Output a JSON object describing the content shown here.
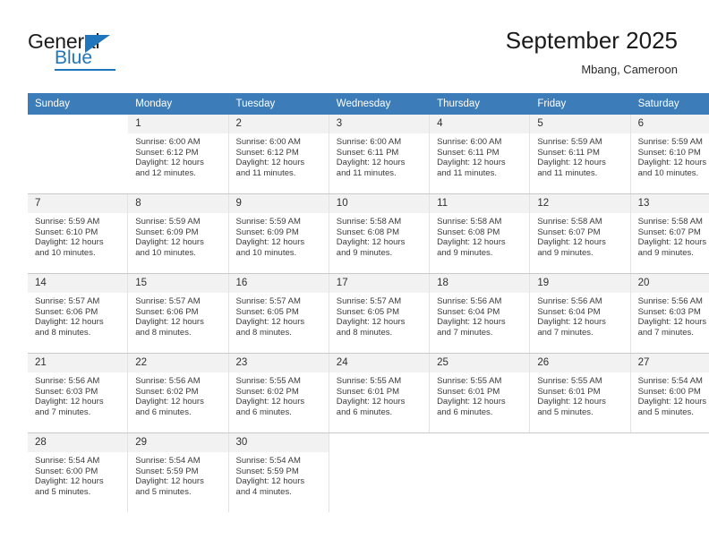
{
  "brand": {
    "name_part1": "General",
    "name_part2": "Blue",
    "accent_color": "#1f76bc"
  },
  "header": {
    "title": "September 2025",
    "subtitle": "Mbang, Cameroon",
    "header_bg": "#3c7cb8"
  },
  "weekday_headers": [
    "Sunday",
    "Monday",
    "Tuesday",
    "Wednesday",
    "Thursday",
    "Friday",
    "Saturday"
  ],
  "labels": {
    "sunrise": "Sunrise:",
    "sunset": "Sunset:",
    "daylight": "Daylight:"
  },
  "weeks": [
    [
      {
        "day": "",
        "blank": true
      },
      {
        "day": "1",
        "sunrise": "Sunrise: 6:00 AM",
        "sunset": "Sunset: 6:12 PM",
        "daylight1": "Daylight: 12 hours",
        "daylight2": "and 12 minutes."
      },
      {
        "day": "2",
        "sunrise": "Sunrise: 6:00 AM",
        "sunset": "Sunset: 6:12 PM",
        "daylight1": "Daylight: 12 hours",
        "daylight2": "and 11 minutes."
      },
      {
        "day": "3",
        "sunrise": "Sunrise: 6:00 AM",
        "sunset": "Sunset: 6:11 PM",
        "daylight1": "Daylight: 12 hours",
        "daylight2": "and 11 minutes."
      },
      {
        "day": "4",
        "sunrise": "Sunrise: 6:00 AM",
        "sunset": "Sunset: 6:11 PM",
        "daylight1": "Daylight: 12 hours",
        "daylight2": "and 11 minutes."
      },
      {
        "day": "5",
        "sunrise": "Sunrise: 5:59 AM",
        "sunset": "Sunset: 6:11 PM",
        "daylight1": "Daylight: 12 hours",
        "daylight2": "and 11 minutes."
      },
      {
        "day": "6",
        "sunrise": "Sunrise: 5:59 AM",
        "sunset": "Sunset: 6:10 PM",
        "daylight1": "Daylight: 12 hours",
        "daylight2": "and 10 minutes."
      }
    ],
    [
      {
        "day": "7",
        "sunrise": "Sunrise: 5:59 AM",
        "sunset": "Sunset: 6:10 PM",
        "daylight1": "Daylight: 12 hours",
        "daylight2": "and 10 minutes."
      },
      {
        "day": "8",
        "sunrise": "Sunrise: 5:59 AM",
        "sunset": "Sunset: 6:09 PM",
        "daylight1": "Daylight: 12 hours",
        "daylight2": "and 10 minutes."
      },
      {
        "day": "9",
        "sunrise": "Sunrise: 5:59 AM",
        "sunset": "Sunset: 6:09 PM",
        "daylight1": "Daylight: 12 hours",
        "daylight2": "and 10 minutes."
      },
      {
        "day": "10",
        "sunrise": "Sunrise: 5:58 AM",
        "sunset": "Sunset: 6:08 PM",
        "daylight1": "Daylight: 12 hours",
        "daylight2": "and 9 minutes."
      },
      {
        "day": "11",
        "sunrise": "Sunrise: 5:58 AM",
        "sunset": "Sunset: 6:08 PM",
        "daylight1": "Daylight: 12 hours",
        "daylight2": "and 9 minutes."
      },
      {
        "day": "12",
        "sunrise": "Sunrise: 5:58 AM",
        "sunset": "Sunset: 6:07 PM",
        "daylight1": "Daylight: 12 hours",
        "daylight2": "and 9 minutes."
      },
      {
        "day": "13",
        "sunrise": "Sunrise: 5:58 AM",
        "sunset": "Sunset: 6:07 PM",
        "daylight1": "Daylight: 12 hours",
        "daylight2": "and 9 minutes."
      }
    ],
    [
      {
        "day": "14",
        "sunrise": "Sunrise: 5:57 AM",
        "sunset": "Sunset: 6:06 PM",
        "daylight1": "Daylight: 12 hours",
        "daylight2": "and 8 minutes."
      },
      {
        "day": "15",
        "sunrise": "Sunrise: 5:57 AM",
        "sunset": "Sunset: 6:06 PM",
        "daylight1": "Daylight: 12 hours",
        "daylight2": "and 8 minutes."
      },
      {
        "day": "16",
        "sunrise": "Sunrise: 5:57 AM",
        "sunset": "Sunset: 6:05 PM",
        "daylight1": "Daylight: 12 hours",
        "daylight2": "and 8 minutes."
      },
      {
        "day": "17",
        "sunrise": "Sunrise: 5:57 AM",
        "sunset": "Sunset: 6:05 PM",
        "daylight1": "Daylight: 12 hours",
        "daylight2": "and 8 minutes."
      },
      {
        "day": "18",
        "sunrise": "Sunrise: 5:56 AM",
        "sunset": "Sunset: 6:04 PM",
        "daylight1": "Daylight: 12 hours",
        "daylight2": "and 7 minutes."
      },
      {
        "day": "19",
        "sunrise": "Sunrise: 5:56 AM",
        "sunset": "Sunset: 6:04 PM",
        "daylight1": "Daylight: 12 hours",
        "daylight2": "and 7 minutes."
      },
      {
        "day": "20",
        "sunrise": "Sunrise: 5:56 AM",
        "sunset": "Sunset: 6:03 PM",
        "daylight1": "Daylight: 12 hours",
        "daylight2": "and 7 minutes."
      }
    ],
    [
      {
        "day": "21",
        "sunrise": "Sunrise: 5:56 AM",
        "sunset": "Sunset: 6:03 PM",
        "daylight1": "Daylight: 12 hours",
        "daylight2": "and 7 minutes."
      },
      {
        "day": "22",
        "sunrise": "Sunrise: 5:56 AM",
        "sunset": "Sunset: 6:02 PM",
        "daylight1": "Daylight: 12 hours",
        "daylight2": "and 6 minutes."
      },
      {
        "day": "23",
        "sunrise": "Sunrise: 5:55 AM",
        "sunset": "Sunset: 6:02 PM",
        "daylight1": "Daylight: 12 hours",
        "daylight2": "and 6 minutes."
      },
      {
        "day": "24",
        "sunrise": "Sunrise: 5:55 AM",
        "sunset": "Sunset: 6:01 PM",
        "daylight1": "Daylight: 12 hours",
        "daylight2": "and 6 minutes."
      },
      {
        "day": "25",
        "sunrise": "Sunrise: 5:55 AM",
        "sunset": "Sunset: 6:01 PM",
        "daylight1": "Daylight: 12 hours",
        "daylight2": "and 6 minutes."
      },
      {
        "day": "26",
        "sunrise": "Sunrise: 5:55 AM",
        "sunset": "Sunset: 6:01 PM",
        "daylight1": "Daylight: 12 hours",
        "daylight2": "and 5 minutes."
      },
      {
        "day": "27",
        "sunrise": "Sunrise: 5:54 AM",
        "sunset": "Sunset: 6:00 PM",
        "daylight1": "Daylight: 12 hours",
        "daylight2": "and 5 minutes."
      }
    ],
    [
      {
        "day": "28",
        "sunrise": "Sunrise: 5:54 AM",
        "sunset": "Sunset: 6:00 PM",
        "daylight1": "Daylight: 12 hours",
        "daylight2": "and 5 minutes."
      },
      {
        "day": "29",
        "sunrise": "Sunrise: 5:54 AM",
        "sunset": "Sunset: 5:59 PM",
        "daylight1": "Daylight: 12 hours",
        "daylight2": "and 5 minutes."
      },
      {
        "day": "30",
        "sunrise": "Sunrise: 5:54 AM",
        "sunset": "Sunset: 5:59 PM",
        "daylight1": "Daylight: 12 hours",
        "daylight2": "and 4 minutes."
      },
      {
        "day": "",
        "blank": true
      },
      {
        "day": "",
        "blank": true
      },
      {
        "day": "",
        "blank": true
      },
      {
        "day": "",
        "blank": true
      }
    ]
  ]
}
